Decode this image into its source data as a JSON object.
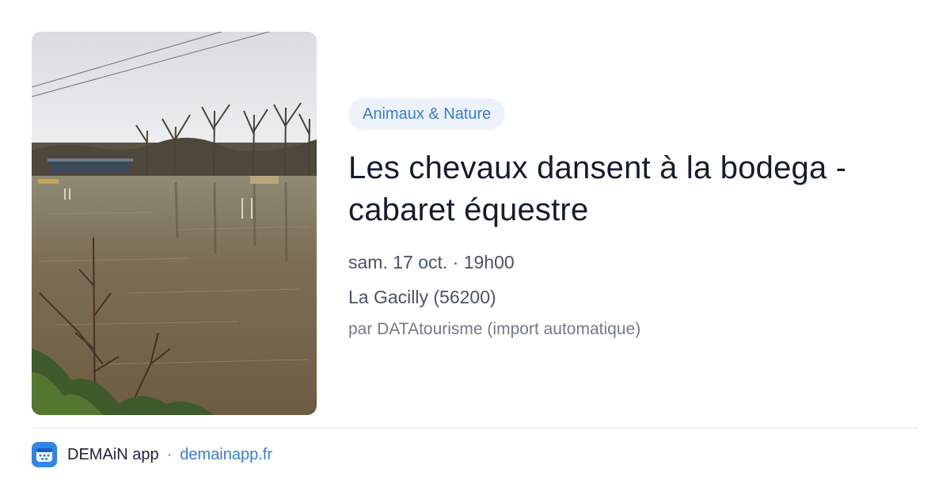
{
  "image": {
    "alt": "Flooded field with bare trees"
  },
  "event": {
    "category": "Animaux & Nature",
    "title": "Les chevaux dansent à la bodega - cabaret équestre",
    "date": "sam. 17 oct. · 19h00",
    "location": "La Gacilly (56200)",
    "source": "par DATAtourisme (import automatique)"
  },
  "footer": {
    "app_name": "DEMAiN app",
    "separator": "·",
    "link": "demainapp.fr",
    "logo_icon": "demain-logo-icon"
  },
  "colors": {
    "accent": "#3b7bd4",
    "pill_bg": "#edf2fa",
    "logo_bg": "#2f86e8"
  }
}
